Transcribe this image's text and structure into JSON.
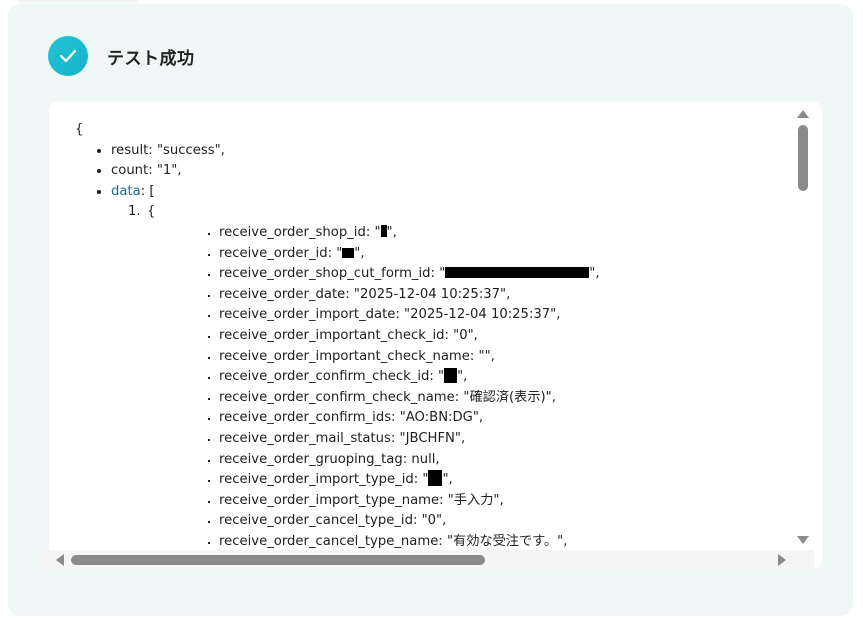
{
  "header": {
    "title": "テスト成功",
    "status_icon": "check-icon",
    "accent_color": "#1fbcd2"
  },
  "code": {
    "open_brace": "{",
    "result_line": "result: \"success\",",
    "count_line": "count: \"1\",",
    "data_key": "data",
    "data_open": ": [",
    "item_number": "1.",
    "item_open": "{",
    "fields": {
      "shop_id_key": "receive_order_shop_id: \"",
      "shop_id_end": "\",",
      "order_id_key": "receive_order_id: \"",
      "order_id_end": "\",",
      "cut_form_id_key": "receive_order_shop_cut_form_id: \"",
      "cut_form_id_end": "\",",
      "order_date": "receive_order_date: \"2025-12-04 10:25:37\",",
      "import_date": "receive_order_import_date: \"2025-12-04 10:25:37\",",
      "important_check_id": "receive_order_important_check_id: \"0\",",
      "important_check_name": "receive_order_important_check_name: \"\",",
      "confirm_check_id_key": "receive_order_confirm_check_id: \"",
      "confirm_check_id_end": "\",",
      "confirm_check_name": "receive_order_confirm_check_name: \"確認済(表示)\",",
      "confirm_ids": "receive_order_confirm_ids: \"AO:BN:DG\",",
      "mail_status": "receive_order_mail_status: \"JBCHFN\",",
      "gruoping_tag": "receive_order_gruoping_tag: null,",
      "import_type_id_key": "receive_order_import_type_id: \"",
      "import_type_id_end": "\",",
      "import_type_name": "receive_order_import_type_name: \"手入力\",",
      "cancel_type_id": "receive_order_cancel_type_id: \"0\",",
      "cancel_type_name": "receive_order_cancel_type_name: \"有効な受注です。\","
    }
  }
}
